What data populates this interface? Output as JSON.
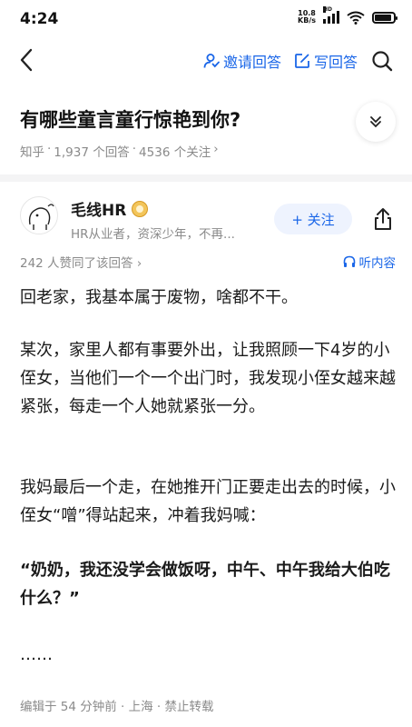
{
  "status_bar": {
    "time": "4:24",
    "net_speed_value": "10.8",
    "net_speed_unit": "KB/s",
    "signal_tag": "HD",
    "battery_level": 0.9
  },
  "nav": {
    "invite_label": "邀请回答",
    "write_label": "写回答"
  },
  "question": {
    "title": "有哪些童言童行惊艳到你?",
    "meta_site": "知乎",
    "meta_dot1": "·",
    "meta_answers": "1,937 个回答",
    "meta_dot2": "·",
    "meta_followers": "4536 个关注",
    "meta_arrow": "›"
  },
  "answer": {
    "author_name": "毛线HR",
    "author_bio": "HR从业者，资深少年，不再...",
    "follow_label": "+ 关注",
    "upvote_text": "242 人赞同了该回答 ›",
    "listen_label": "听内容",
    "paragraphs": [
      "回老家，我基本属于废物，啥都不干。",
      "某次，家里人都有事要外出，让我照顾一下4岁的小侄女，当他们一个一个出门时，我发现小侄女越来越紧张，每走一个人她就紧张一分。",
      "我妈最后一个走，在她推开门正要走出去的时候，小侄女“噌”得站起来，冲着我妈喊：",
      "“奶奶，我还没学会做饭呀，中午、中午我给大伯吃什么？”",
      "……"
    ],
    "footer": "编辑于 54 分钟前 · 上海 · 禁止转载"
  },
  "colors": {
    "accent": "#1a66e8",
    "meta_gray": "#8a8a8a",
    "follow_bg": "#eef3fe"
  },
  "icons": [
    "back-arrow-icon",
    "invite-person-icon",
    "write-edit-icon",
    "search-icon",
    "collapse-chevrons-icon",
    "share-icon",
    "headphones-icon",
    "medal-badge-icon"
  ]
}
